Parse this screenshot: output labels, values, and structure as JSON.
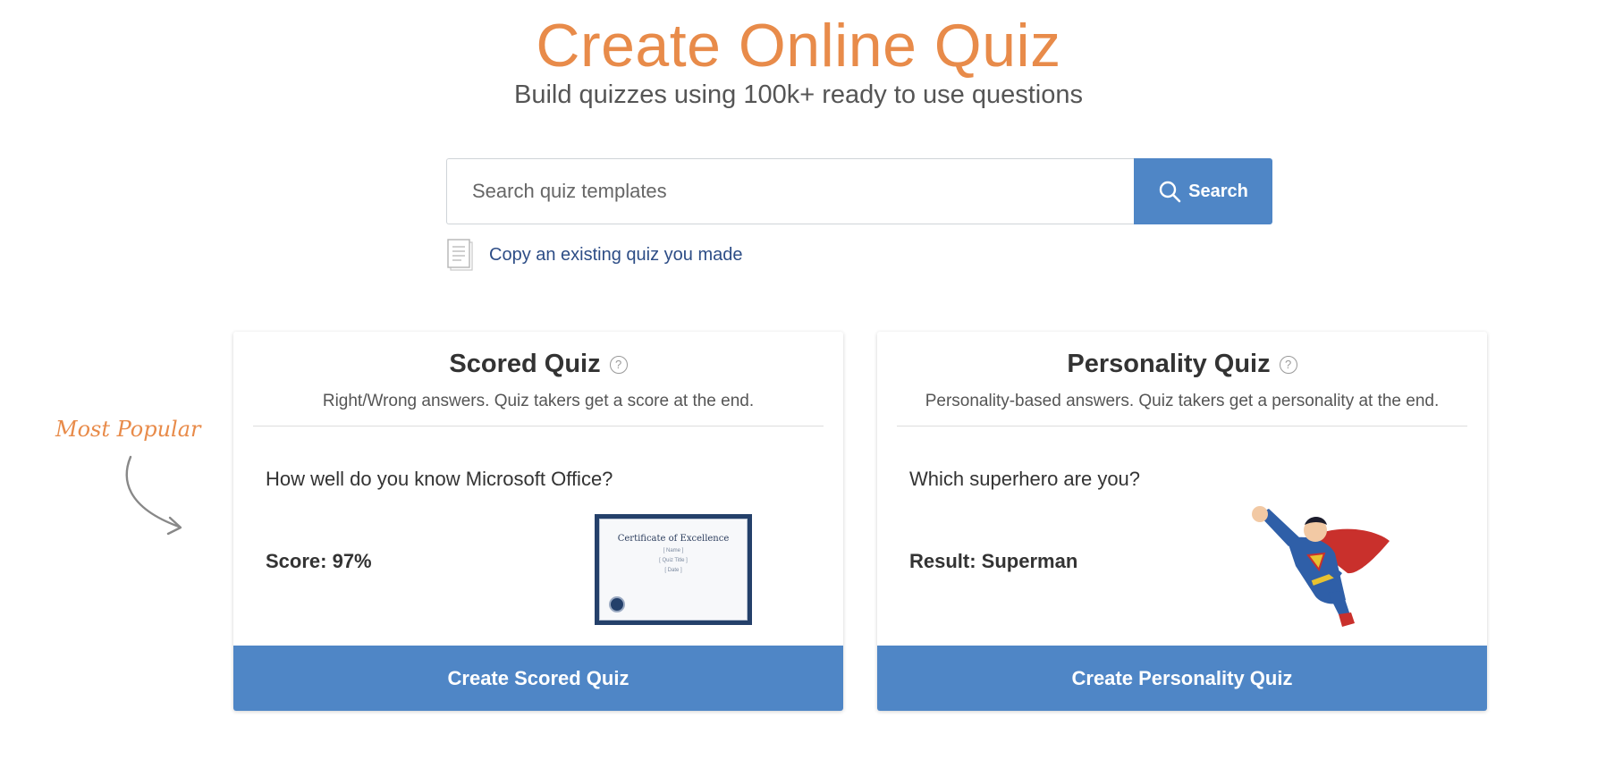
{
  "header": {
    "title": "Create Online Quiz",
    "subtitle": "Build quizzes using 100k+ ready to use questions"
  },
  "search": {
    "placeholder": "Search quiz templates",
    "button_label": "Search",
    "button_icon": "search-icon"
  },
  "copy_link": {
    "label": "Copy an existing quiz you made",
    "icon": "document-icon"
  },
  "annotation": {
    "label": "Most Popular"
  },
  "colors": {
    "accent_orange": "#e88b4a",
    "primary_blue": "#4f86c6",
    "link_blue": "#2d4d86"
  },
  "cards": [
    {
      "title": "Scored Quiz",
      "help_icon": "?",
      "description": "Right/Wrong answers. Quiz takers get a score at the end.",
      "example_question": "How well do you know Microsoft Office?",
      "example_result": "Score: 97%",
      "certificate": {
        "title": "Certificate of Excellence",
        "lines": [
          "[ Name ]",
          "[ Quiz Title ]",
          "[ Date ]"
        ]
      },
      "button_label": "Create Scored Quiz"
    },
    {
      "title": "Personality Quiz",
      "help_icon": "?",
      "description": "Personality-based answers. Quiz takers get a personality at the end.",
      "example_question": "Which superhero are you?",
      "example_result": "Result: Superman",
      "button_label": "Create Personality Quiz"
    }
  ]
}
